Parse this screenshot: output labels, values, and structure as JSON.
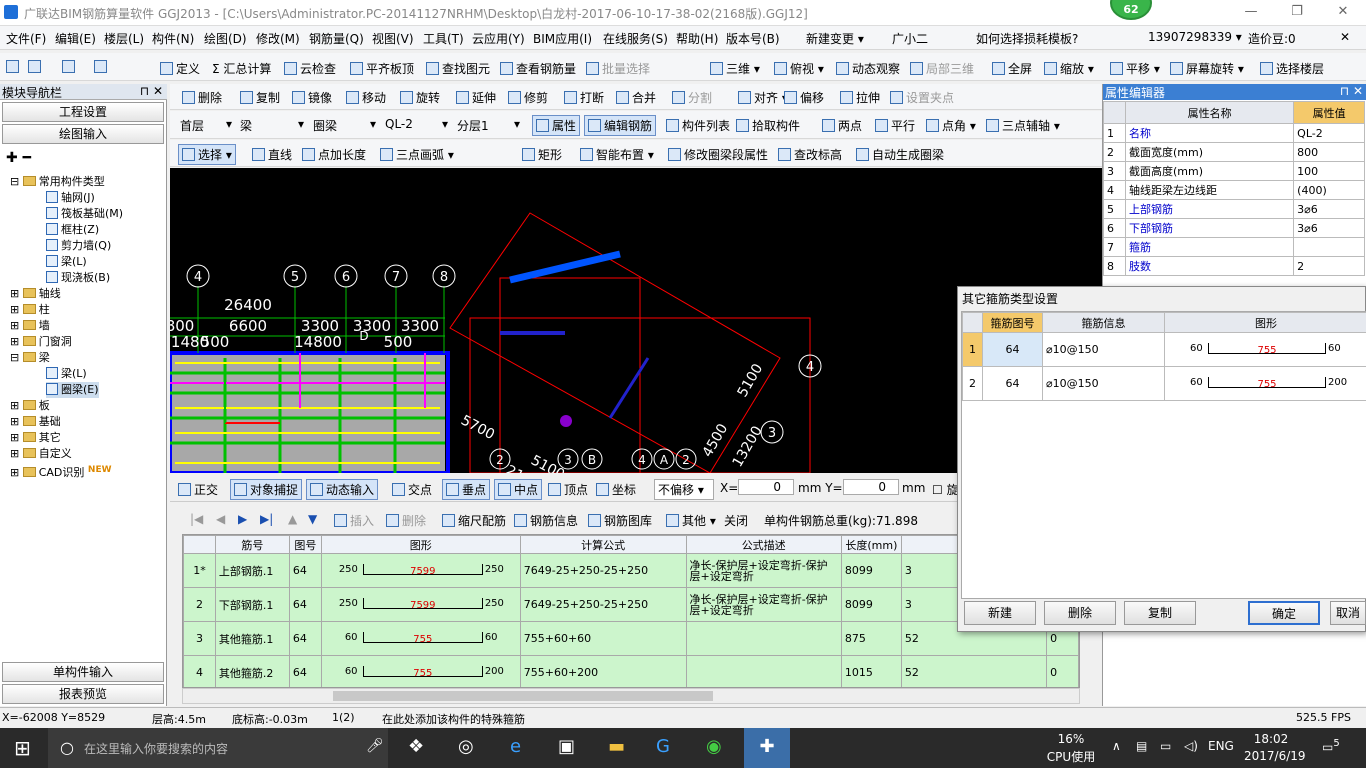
{
  "title": "广联达BIM钢筋算量软件 GGJ2013 - [C:\\Users\\Administrator.PC-20141127NRHM\\Desktop\\白龙村-2017-06-10-17-38-02(2168版).GGJ12]",
  "badge": "62",
  "window_controls": [
    "—",
    "❐",
    "✕"
  ],
  "menu": [
    "文件(F)",
    "编辑(E)",
    "楼层(L)",
    "构件(N)",
    "绘图(D)",
    "修改(M)",
    "钢筋量(Q)",
    "视图(V)",
    "工具(T)",
    "云应用(Y)",
    "BIM应用(I)",
    "在线服务(S)",
    "帮助(H)",
    "版本号(B)",
    "新建变更 ▾",
    "广小二"
  ],
  "menu_right": {
    "help_link": "如何选择损耗模板?",
    "phone": "13907298339 ▾",
    "price": "造价豆:0",
    "close": "✕"
  },
  "toolbar1": [
    "定义",
    "Σ 汇总计算",
    "云检查",
    "平齐板顶",
    "查找图元",
    "查看钢筋量",
    "批量选择",
    "三维 ▾",
    "俯视 ▾",
    "动态观察",
    "局部三维",
    "全屏",
    "缩放 ▾",
    "平移 ▾",
    "屏幕旋转 ▾",
    "选择楼层"
  ],
  "toolbar2": [
    "删除",
    "复制",
    "镜像",
    "移动",
    "旋转",
    "延伸",
    "修剪",
    "打断",
    "合并",
    "分割",
    "对齐 ▾",
    "偏移",
    "拉伸",
    "设置夹点"
  ],
  "toolbar3": {
    "floor": "首层",
    "type": "梁",
    "sub": "圈梁",
    "name": "QL-2",
    "layer": "分层1",
    "buttons": [
      "属性",
      "编辑钢筋",
      "构件列表",
      "拾取构件",
      "两点",
      "平行",
      "点角 ▾",
      "三点辅轴 ▾"
    ]
  },
  "toolbar4": [
    "选择 ▾",
    "直线",
    "点加长度",
    "三点画弧 ▾",
    "矩形",
    "智能布置 ▾",
    "修改圈梁段属性",
    "查改标高",
    "自动生成圈梁"
  ],
  "nav": {
    "header": "模块导航栏",
    "btn1": "工程设置",
    "btn2": "绘图输入",
    "tree": [
      "常用构件类型",
      "轴网(J)",
      "筏板基础(M)",
      "框柱(Z)",
      "剪力墙(Q)",
      "梁(L)",
      "现浇板(B)",
      "轴线",
      "柱",
      "墙",
      "门窗洞",
      "梁",
      "梁(L)",
      "圈梁(E)",
      "板",
      "基础",
      "其它",
      "自定义",
      "CAD识别"
    ],
    "new_tag": "NEW",
    "bottom1": "单构件输入",
    "bottom2": "报表预览"
  },
  "canvas": {
    "dims_top": [
      "26400",
      "6600",
      "3300",
      "3300",
      "3300",
      "800"
    ],
    "dims_row2": [
      "14800",
      "1480",
      "500",
      "500",
      "D"
    ],
    "axis_nums": [
      "4",
      "5",
      "6",
      "7",
      "8"
    ],
    "rot_labels": [
      "5700",
      "5100",
      "4500",
      "13200",
      "5100",
      "2150"
    ],
    "right_axes": [
      "4",
      "3"
    ],
    "bottom_axes": [
      "2",
      "3",
      "B",
      "4",
      "A",
      "2"
    ]
  },
  "snap": {
    "buttons": [
      "正交",
      "对象捕捉",
      "动态输入",
      "交点",
      "垂点",
      "中点",
      "顶点",
      "坐标"
    ],
    "offset": "不偏移",
    "x_label": "X=",
    "x_val": "0",
    "y_label": "mm Y=",
    "y_val": "0",
    "unit": "mm",
    "cut": "旋"
  },
  "gridtb": {
    "buttons": [
      "插入",
      "删除",
      "缩尺配筋",
      "钢筋信息",
      "钢筋图库",
      "其他 ▾",
      "关闭"
    ],
    "total": "单构件钢筋总重(kg):71.898"
  },
  "grid": {
    "headers": [
      "",
      "筋号",
      "图号",
      "图形",
      "计算公式",
      "公式描述",
      "长度(mm)",
      "",
      ""
    ],
    "rows": [
      {
        "n": "1*",
        "name": "上部钢筋.1",
        "fig": "64",
        "l": "250",
        "mid": "7599",
        "r": "250",
        "formula": "7649-25+250-25+250",
        "desc": "净长-保护层+设定弯折-保护层+设定弯折",
        "len": "8099",
        "cnt": "3",
        "x": ""
      },
      {
        "n": "2",
        "name": "下部钢筋.1",
        "fig": "64",
        "l": "250",
        "mid": "7599",
        "r": "250",
        "formula": "7649-25+250-25+250",
        "desc": "净长-保护层+设定弯折-保护层+设定弯折",
        "len": "8099",
        "cnt": "3",
        "x": ""
      },
      {
        "n": "3",
        "name": "其他箍筋.1",
        "fig": "64",
        "l": "60",
        "mid": "755",
        "r": "60",
        "formula": "755+60+60",
        "desc": "",
        "len": "875",
        "cnt": "52",
        "x": "0"
      },
      {
        "n": "4",
        "name": "其他箍筋.2",
        "fig": "64",
        "l": "60",
        "mid": "755",
        "r": "200",
        "formula": "755+60+200",
        "desc": "",
        "len": "1015",
        "cnt": "52",
        "x": "0"
      }
    ]
  },
  "props": {
    "header": "属性编辑器",
    "col1": "属性名称",
    "col2": "属性值",
    "rows": [
      [
        "1",
        "名称",
        "QL-2",
        true
      ],
      [
        "2",
        "截面宽度(mm)",
        "800",
        false
      ],
      [
        "3",
        "截面高度(mm)",
        "100",
        false
      ],
      [
        "4",
        "轴线距梁左边线距",
        "(400)",
        false
      ],
      [
        "5",
        "上部钢筋",
        "3⌀6",
        true
      ],
      [
        "6",
        "下部钢筋",
        "3⌀6",
        true
      ],
      [
        "7",
        "箍筋",
        "",
        true
      ],
      [
        "8",
        "肢数",
        "2",
        true
      ]
    ]
  },
  "dialog": {
    "title": "其它箍筋类型设置",
    "headers": [
      "",
      "箍筋图号",
      "箍筋信息",
      "图形"
    ],
    "rows": [
      {
        "n": "1",
        "fig": "64",
        "info": "⌀10@150",
        "l": "60",
        "mid": "755",
        "r": "60"
      },
      {
        "n": "2",
        "fig": "64",
        "info": "⌀10@150",
        "l": "60",
        "mid": "755",
        "r": "200"
      }
    ],
    "buttons": [
      "新建",
      "删除",
      "复制",
      "确定",
      "取消"
    ]
  },
  "status": {
    "coord": "X=-62008 Y=8529",
    "floor_h": "层高:4.5m",
    "bottom_h": "底标高:-0.03m",
    "count": "1(2)",
    "hint": "在此处添加该构件的特殊箍筋",
    "fps": "525.5 FPS"
  },
  "taskbar": {
    "search": "在这里输入你要搜索的内容",
    "cpu": "16%",
    "cpu_label": "CPU使用",
    "lang": "ENG",
    "time": "18:02",
    "date": "2017/6/19",
    "notif": "5"
  }
}
